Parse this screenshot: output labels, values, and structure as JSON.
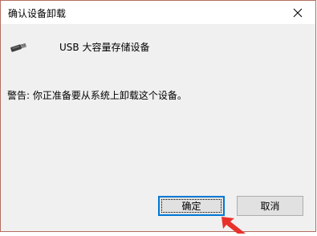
{
  "dialog": {
    "title": "确认设备卸载",
    "close_glyph": "✕",
    "device_icon": "usb-drive-icon",
    "device_name": "USB 大容量存储设备",
    "warning": "警告: 你正准备要从系统上卸载这个设备。",
    "ok_label": "确定",
    "cancel_label": "取消"
  },
  "colors": {
    "accent": "#0078d7",
    "window_border": "#b46e60",
    "arrow": "#e8312a"
  }
}
